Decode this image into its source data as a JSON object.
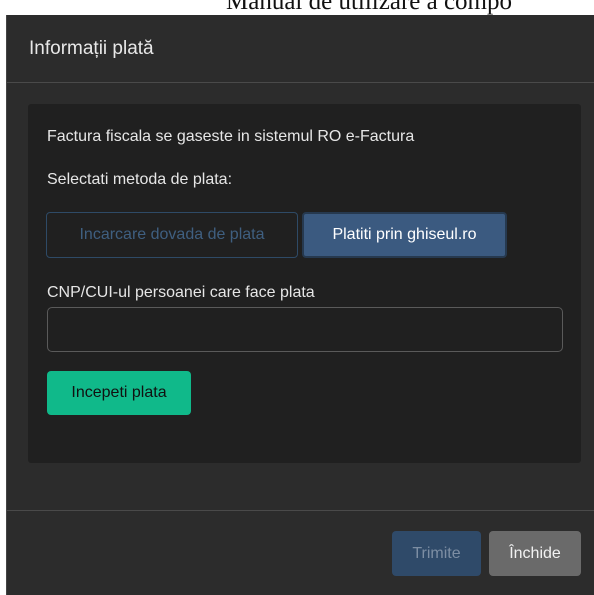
{
  "background": {
    "title": "Manual de utilizare a compo"
  },
  "modal": {
    "title": "Informații plată",
    "info_text": "Factura fiscala se gaseste in sistemul RO e-Factura",
    "method_prompt": "Selectati metoda de plata:",
    "payment_methods": {
      "upload_label": "Incarcare dovada de plata",
      "ghiseul_label": "Platiti prin ghiseul.ro",
      "selected": "Platiti prin ghiseul.ro"
    },
    "cnp_label": "CNP/CUI-ul persoanei care face plata",
    "cnp_value": "",
    "cnp_placeholder": "",
    "start_payment_label": "Incepeti plata",
    "footer": {
      "submit_label": "Trimite",
      "close_label": "Închide"
    }
  },
  "colors": {
    "modal_bg": "#2c2c2c",
    "panel_bg": "#202020",
    "primary": "#3b5a80",
    "success": "#10b98a",
    "secondary": "#6a6a6a"
  }
}
